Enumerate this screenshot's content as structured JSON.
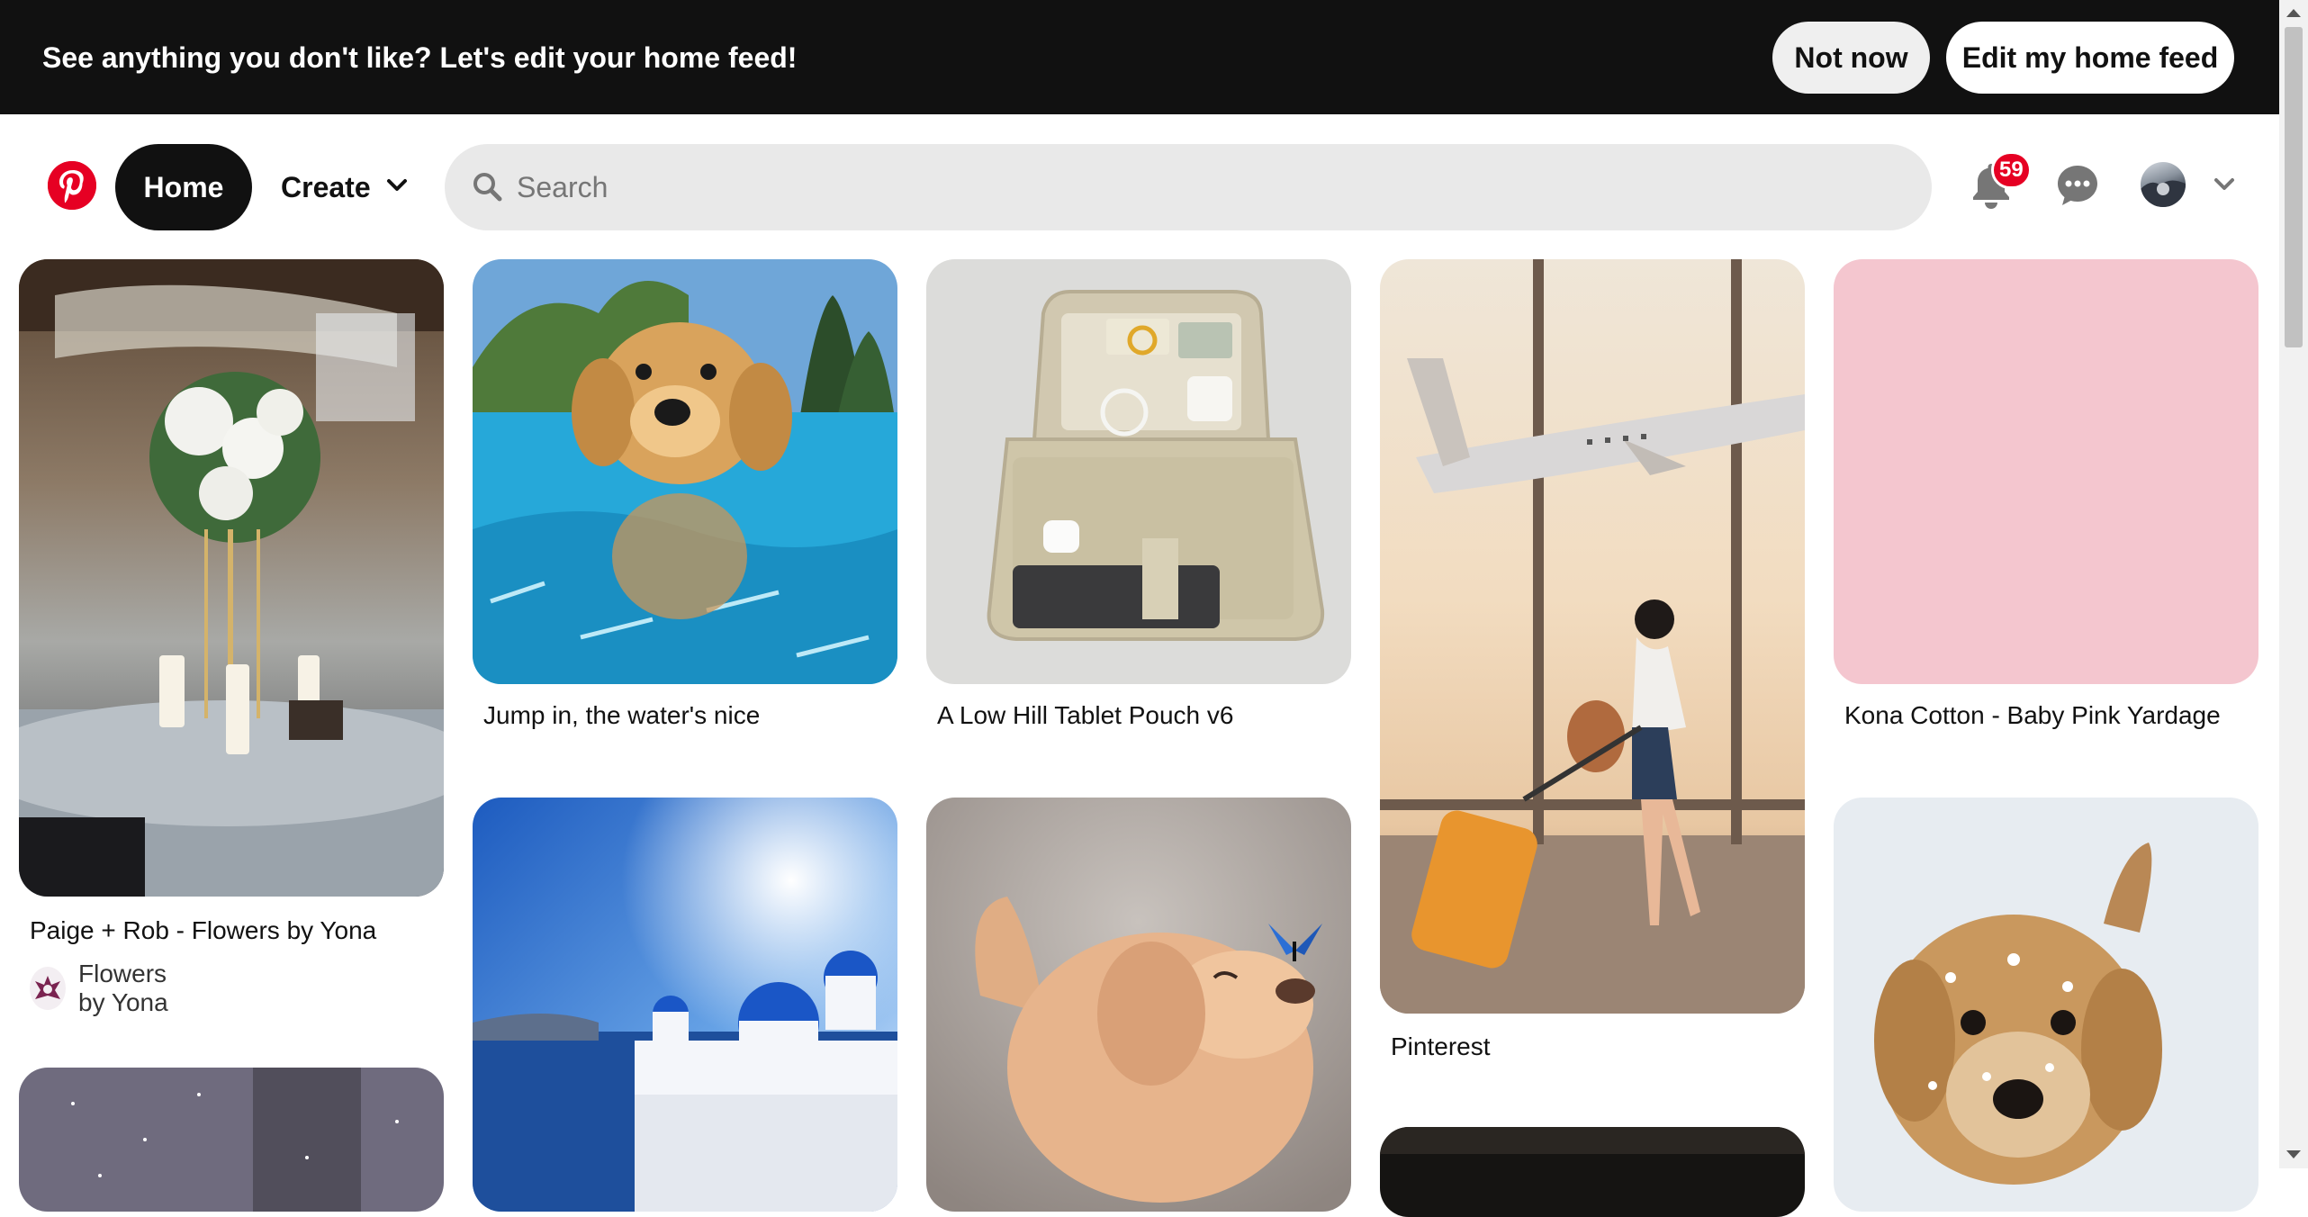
{
  "banner": {
    "text": "See anything you don't like? Let's edit your home feed!",
    "not_now_label": "Not now",
    "edit_label": "Edit my home feed"
  },
  "header": {
    "home_label": "Home",
    "create_label": "Create",
    "search_placeholder": "Search",
    "notification_count": "59",
    "icons": {
      "logo": "pinterest-logo",
      "create": "chevron-down-icon",
      "search": "search-icon",
      "notifications": "bell-icon",
      "messages": "chat-bubble-icon",
      "account_menu": "chevron-down-icon"
    }
  },
  "pins": [
    {
      "title": "Paige + Rob - Flowers by Yona",
      "creator": "Flowers by Yona",
      "image": "wedding table with white floral centerpiece"
    },
    {
      "title": "Jump in, the water's nice",
      "image": "golden puppy swimming in pool"
    },
    {
      "title": "A Low Hill Tablet Pouch v6",
      "image": "open beige tablet pouch"
    },
    {
      "title": "Pinterest",
      "image": "illustration of girl with suitcase at airport window"
    },
    {
      "title": "Kona Cotton - Baby Pink Yardage",
      "image": "solid baby pink fabric"
    },
    {
      "title": "",
      "image": "glittery purple fabric"
    },
    {
      "title": "",
      "image": "Santorini blue domes"
    },
    {
      "title": "",
      "image": "puppy with blue butterfly on nose"
    },
    {
      "title": "",
      "image": "dark image"
    },
    {
      "title": "",
      "image": "puppy in snow"
    }
  ],
  "colors": {
    "brand_red": "#e60023",
    "banner_bg": "#111111",
    "search_bg": "#e9e9e9",
    "pink_swatch": "#f4c6cf"
  }
}
